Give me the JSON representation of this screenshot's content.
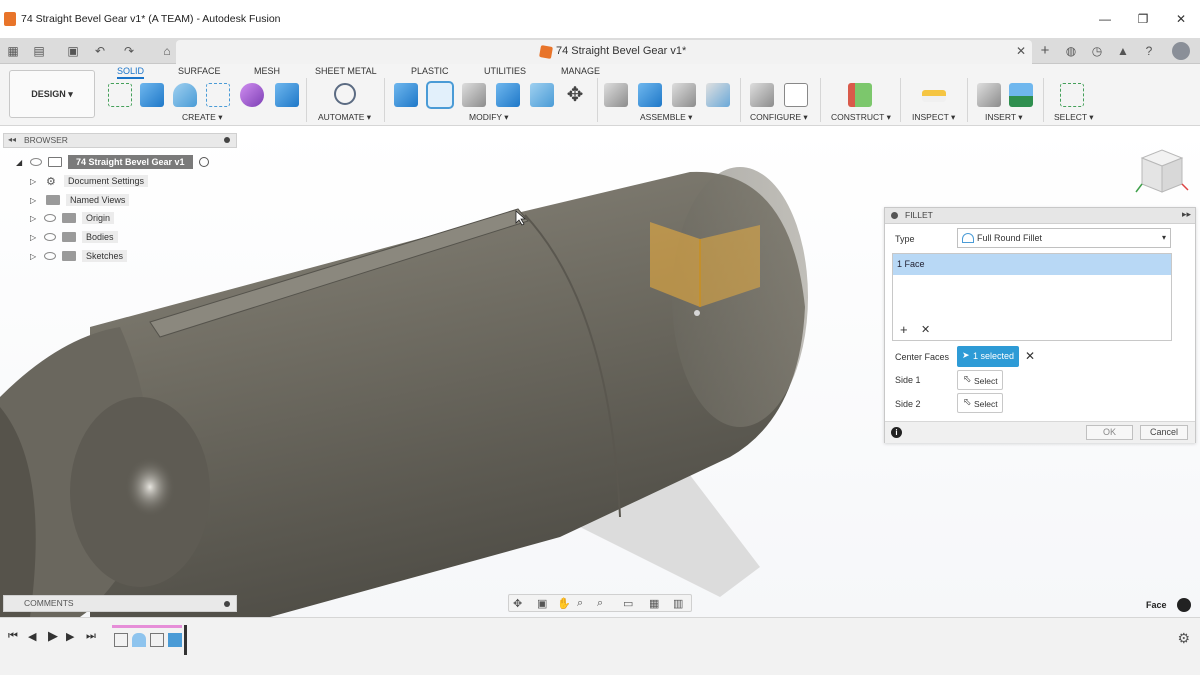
{
  "window": {
    "title": "74 Straight Bevel Gear v1* (A TEAM) - Autodesk Fusion",
    "minimize": "—",
    "maximize": "❐",
    "close": "✕"
  },
  "document_tab": {
    "label": "74 Straight Bevel Gear v1*",
    "close": "✕"
  },
  "workspace": {
    "label": "DESIGN ▾"
  },
  "ribbon_tabs": [
    "SOLID",
    "SURFACE",
    "MESH",
    "SHEET METAL",
    "PLASTIC",
    "UTILITIES",
    "MANAGE"
  ],
  "ribbon_groups": [
    "CREATE ▾",
    "AUTOMATE ▾",
    "MODIFY ▾",
    "ASSEMBLE ▾",
    "CONFIGURE ▾",
    "CONSTRUCT ▾",
    "INSPECT ▾",
    "INSERT ▾",
    "SELECT ▾"
  ],
  "browser": {
    "title": "BROWSER",
    "root": "74 Straight Bevel Gear v1",
    "items": [
      "Document Settings",
      "Named Views",
      "Origin",
      "Bodies",
      "Sketches"
    ]
  },
  "comments": {
    "title": "COMMENTS"
  },
  "fillet": {
    "title": "FILLET",
    "type_label": "Type",
    "type_value": "Full Round Fillet",
    "list_item": "1 Face",
    "center_faces_label": "Center Faces",
    "center_faces_value": "1 selected",
    "side1_label": "Side 1",
    "side1_value": "Select",
    "side2_label": "Side 2",
    "side2_value": "Select",
    "ok": "OK",
    "cancel": "Cancel"
  },
  "status": {
    "selection_type": "Face"
  },
  "colors": {
    "accent": "#1a74c9",
    "selected_button": "#2e9bd6",
    "list_selection": "#b8d8f5",
    "body": "#7d7a70"
  }
}
